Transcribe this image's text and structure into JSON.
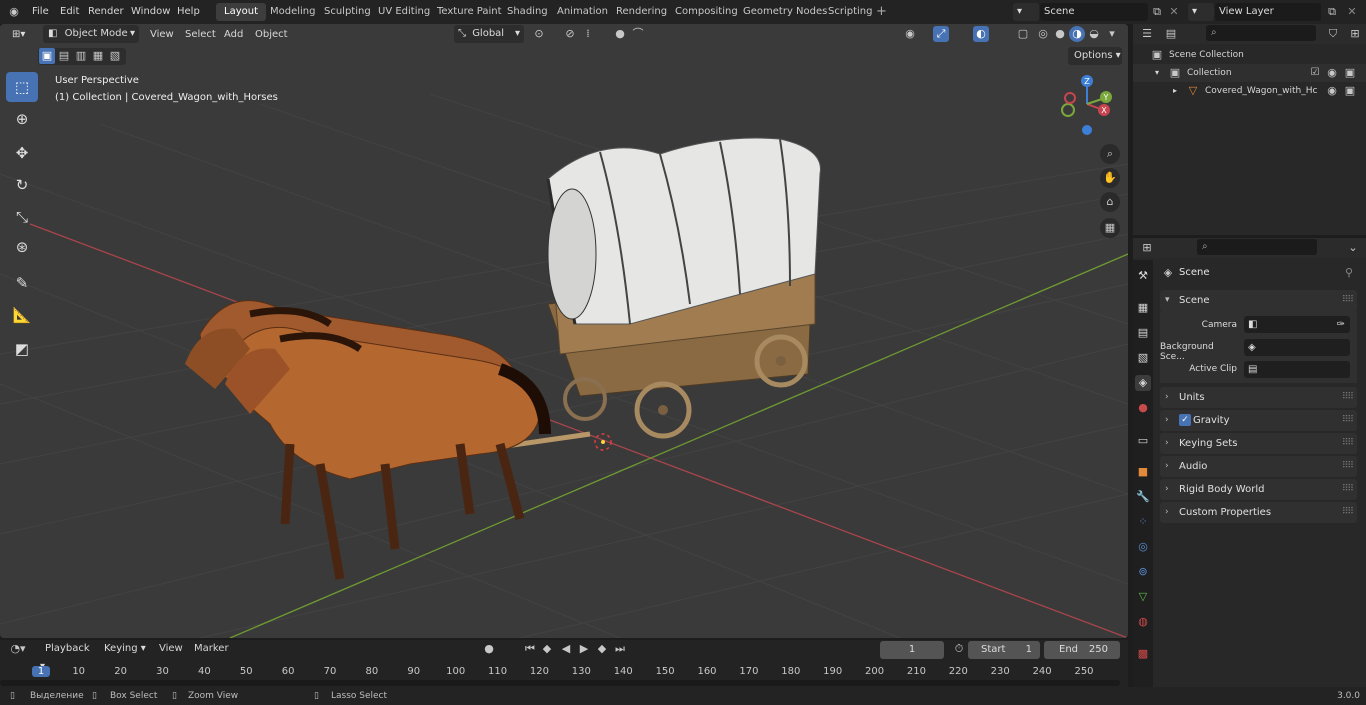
{
  "topbar": {
    "menus": [
      "File",
      "Edit",
      "Render",
      "Window",
      "Help"
    ],
    "workspaces": [
      "Layout",
      "Modeling",
      "Sculpting",
      "UV Editing",
      "Texture Paint",
      "Shading",
      "Animation",
      "Rendering",
      "Compositing",
      "Geometry Nodes",
      "Scripting"
    ],
    "active_workspace": "Layout",
    "add_workspace": "+",
    "scene_name": "Scene",
    "view_layer": "View Layer"
  },
  "viewport_header": {
    "mode": "Object Mode",
    "menus": [
      "View",
      "Select",
      "Add",
      "Object"
    ],
    "orientation": "Global",
    "options_label": "Options"
  },
  "viewport": {
    "view_name": "User Perspective",
    "collection_info": "(1) Collection | Covered_Wagon_with_Horses"
  },
  "outliner": {
    "root": "Scene Collection",
    "collection": "Collection",
    "object": "Covered_Wagon_with_Hc"
  },
  "properties": {
    "context": "Scene",
    "scene_panel": "Scene",
    "fields": [
      {
        "label": "Camera",
        "value": ""
      },
      {
        "label": "Background Sce...",
        "value": ""
      },
      {
        "label": "Active Clip",
        "value": ""
      }
    ],
    "panels": [
      "Units",
      "Gravity",
      "Keying Sets",
      "Audio",
      "Rigid Body World",
      "Custom Properties"
    ],
    "gravity_checked": true
  },
  "timeline": {
    "menus": [
      "Playback",
      "Keying",
      "View",
      "Marker"
    ],
    "current_frame": "1",
    "start_label": "Start",
    "start": "1",
    "end_label": "End",
    "end": "250",
    "ticks": [
      "1",
      "10",
      "20",
      "30",
      "40",
      "50",
      "60",
      "70",
      "80",
      "90",
      "100",
      "110",
      "120",
      "130",
      "140",
      "150",
      "160",
      "170",
      "180",
      "190",
      "200",
      "210",
      "220",
      "230",
      "240",
      "250"
    ]
  },
  "statusbar": {
    "select": "Выделение",
    "box_select": "Box Select",
    "zoom_view": "Zoom View",
    "lasso_select": "Lasso Select",
    "version": "3.0.0"
  },
  "colors": {
    "accent": "#4772b3",
    "x_axis": "#c8454f",
    "y_axis": "#7aa83a",
    "z_axis": "#3d7fd6",
    "frame_marker": "#4772b3"
  }
}
